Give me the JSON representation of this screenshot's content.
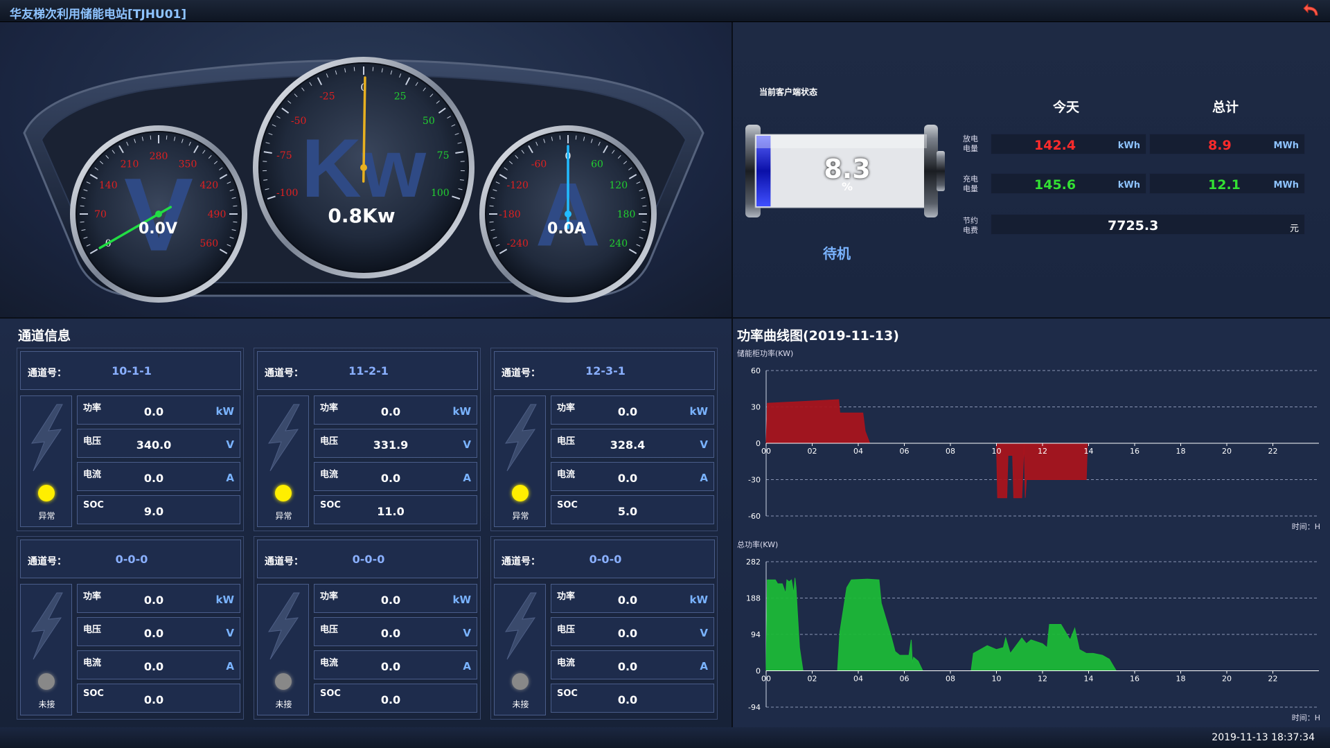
{
  "app": {
    "title": "华友梯次利用储能电站[TJHU01]"
  },
  "gauges": {
    "voltage": {
      "symbol": "V",
      "readout": "0.0V",
      "ticks": [
        "0",
        "70",
        "140",
        "210",
        "280",
        "350",
        "420",
        "490",
        "560"
      ],
      "needle_value": 0
    },
    "power": {
      "symbol": "Kw",
      "readout": "0.8Kw",
      "ticks": [
        "-100",
        "-75",
        "-50",
        "-25",
        "0",
        "25",
        "50",
        "75",
        "100"
      ],
      "needle_value": 0.8
    },
    "current": {
      "symbol": "A",
      "readout": "0.0A",
      "ticks": [
        "-240",
        "-180",
        "-120",
        "-60",
        "0",
        "60",
        "120",
        "180",
        "240"
      ],
      "needle_value": 0
    }
  },
  "status": {
    "client_label": "当前客户端状态",
    "soc_value": "8.3",
    "soc_unit": "%",
    "soc_fraction": 0.083,
    "state": "待机",
    "today_header": "今天",
    "total_header": "总计",
    "discharge_label": "放电电量",
    "charge_label": "充电电量",
    "savings_label": "节约电费",
    "discharge_today": "142.4",
    "discharge_today_unit": "kWh",
    "discharge_total": "8.9",
    "discharge_total_unit": "MWh",
    "charge_today": "145.6",
    "charge_today_unit": "kWh",
    "charge_total": "12.1",
    "charge_total_unit": "MWh",
    "savings": "7725.3",
    "savings_unit": "元",
    "colors": {
      "discharge": "#ff2b2b",
      "charge": "#33e033"
    }
  },
  "channels": {
    "title": "通道信息",
    "channel_label": "通道号：",
    "power_label": "功率",
    "voltage_label": "电压",
    "current_label": "电流",
    "soc_label": "SOC",
    "power_unit": "kW",
    "voltage_unit": "V",
    "current_unit": "A",
    "items": [
      {
        "id": "10-1-1",
        "power": "0.0",
        "voltage": "340.0",
        "current": "0.0",
        "soc": "9.0",
        "status": "异常",
        "dot_color": "#ffee00"
      },
      {
        "id": "11-2-1",
        "power": "0.0",
        "voltage": "331.9",
        "current": "0.0",
        "soc": "11.0",
        "status": "异常",
        "dot_color": "#ffee00"
      },
      {
        "id": "12-3-1",
        "power": "0.0",
        "voltage": "328.4",
        "current": "0.0",
        "soc": "5.0",
        "status": "异常",
        "dot_color": "#ffee00"
      },
      {
        "id": "0-0-0",
        "power": "0.0",
        "voltage": "0.0",
        "current": "0.0",
        "soc": "0.0",
        "status": "未接",
        "dot_color": "#888888"
      },
      {
        "id": "0-0-0",
        "power": "0.0",
        "voltage": "0.0",
        "current": "0.0",
        "soc": "0.0",
        "status": "未接",
        "dot_color": "#888888"
      },
      {
        "id": "0-0-0",
        "power": "0.0",
        "voltage": "0.0",
        "current": "0.0",
        "soc": "0.0",
        "status": "未接",
        "dot_color": "#888888"
      }
    ]
  },
  "chart_panel": {
    "title": "功率曲线图(2019-11-13)"
  },
  "chart_data": [
    {
      "type": "area",
      "ylabel": "储能柜功率(KW)",
      "xlabel": "时间：H",
      "ylim": [
        -60,
        60
      ],
      "yticks": [
        60,
        30,
        0,
        -30,
        -60
      ],
      "xticks": [
        "00",
        "02",
        "04",
        "06",
        "08",
        "10",
        "12",
        "14",
        "16",
        "18",
        "20",
        "22"
      ],
      "xlim": [
        0,
        24
      ],
      "color": "#a8141e",
      "x": [
        0,
        0.05,
        3.15,
        3.2,
        4.2,
        4.3,
        4.5,
        4.6,
        9.9,
        10.0,
        10.05,
        10.45,
        10.5,
        10.7,
        10.75,
        11.1,
        11.2,
        11.25,
        11.3,
        13.9,
        13.95,
        24
      ],
      "y": [
        0,
        33,
        36,
        25,
        25,
        10,
        0,
        0,
        0,
        0,
        -45,
        -45,
        -10,
        -10,
        -45,
        -45,
        0,
        -45,
        -30,
        -30,
        0,
        0
      ]
    },
    {
      "type": "area",
      "ylabel": "总功率(KW)",
      "xlabel": "时间：H",
      "ylim": [
        -94,
        282
      ],
      "yticks": [
        282,
        188,
        94,
        0,
        -94
      ],
      "xticks": [
        "00",
        "02",
        "04",
        "06",
        "08",
        "10",
        "12",
        "14",
        "16",
        "18",
        "20",
        "22"
      ],
      "xlim": [
        0,
        24
      ],
      "color": "#1cb838",
      "x": [
        0,
        0.05,
        0.4,
        0.5,
        0.7,
        0.85,
        0.9,
        1.0,
        1.1,
        1.2,
        1.25,
        1.3,
        1.35,
        1.45,
        1.6,
        3.1,
        3.2,
        3.5,
        3.7,
        4.4,
        4.9,
        5.0,
        5.4,
        5.6,
        5.8,
        6.2,
        6.3,
        6.35,
        6.4,
        6.6,
        6.8,
        8.9,
        9.0,
        9.3,
        9.6,
        10.0,
        10.3,
        10.4,
        10.6,
        11.1,
        11.3,
        11.5,
        12.0,
        12.2,
        12.3,
        12.8,
        13.0,
        13.2,
        13.4,
        13.6,
        13.9,
        14.2,
        14.6,
        14.9,
        15.2,
        24
      ],
      "y": [
        0,
        235,
        235,
        225,
        225,
        200,
        235,
        230,
        235,
        200,
        240,
        215,
        160,
        60,
        0,
        0,
        100,
        215,
        235,
        237,
        235,
        175,
        95,
        50,
        40,
        40,
        80,
        20,
        35,
        25,
        0,
        0,
        45,
        55,
        65,
        55,
        60,
        85,
        45,
        85,
        70,
        80,
        70,
        60,
        120,
        120,
        100,
        80,
        110,
        55,
        45,
        45,
        40,
        30,
        0,
        0
      ]
    }
  ],
  "footer": {
    "datetime": "2019-11-13 18:37:34"
  }
}
